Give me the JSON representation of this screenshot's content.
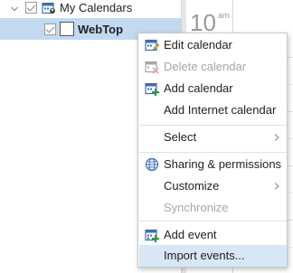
{
  "sidebar": {
    "parent": {
      "label": "My Calendars",
      "checked": true,
      "expanded": true
    },
    "child": {
      "label": "WebTop",
      "checked": true,
      "selected": true
    }
  },
  "grid": {
    "hour": "10",
    "ampm": "am"
  },
  "menu": {
    "items": [
      {
        "label": "Edit calendar",
        "icon": "edit-calendar-icon",
        "disabled": false
      },
      {
        "label": "Delete calendar",
        "icon": "delete-calendar-icon",
        "disabled": true
      },
      {
        "label": "Add calendar",
        "icon": "add-calendar-icon",
        "disabled": false
      },
      {
        "label": "Add Internet calendar",
        "icon": "",
        "disabled": false
      },
      {
        "label": "Select",
        "submenu": true,
        "disabled": false
      },
      {
        "label": "Sharing & permissions",
        "icon": "globe-icon",
        "disabled": false
      },
      {
        "label": "Customize",
        "submenu": true,
        "disabled": false
      },
      {
        "label": "Synchronize",
        "disabled": true
      },
      {
        "label": "Add event",
        "icon": "add-event-icon",
        "disabled": false
      },
      {
        "label": "Import events...",
        "disabled": false,
        "hovered": true
      }
    ]
  },
  "colors": {
    "selection": "#c3d9f0",
    "hover": "#d8e7f5",
    "icon_blue": "#3b6fb6",
    "icon_red": "#d9534f",
    "icon_green": "#2e9a44"
  }
}
